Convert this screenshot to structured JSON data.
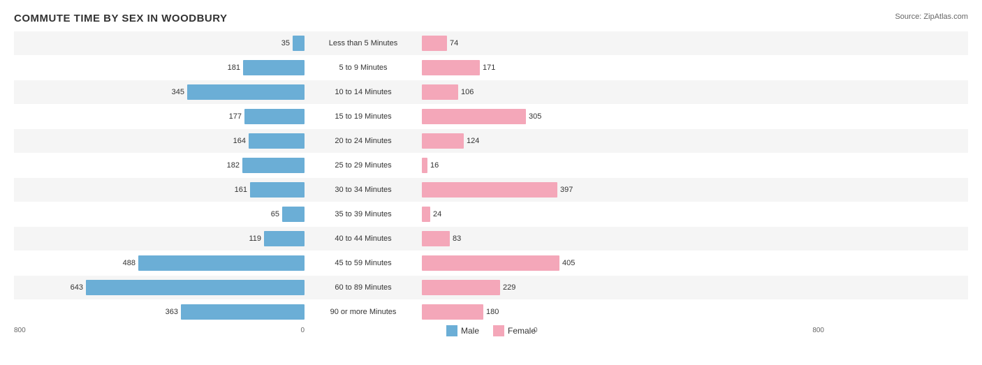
{
  "title": "COMMUTE TIME BY SEX IN WOODBURY",
  "source": "Source: ZipAtlas.com",
  "max_value": 800,
  "axis_labels": {
    "left_min": "800",
    "left_max": "0",
    "right_min": "0",
    "right_max": "800"
  },
  "legend": {
    "male_label": "Male",
    "female_label": "Female"
  },
  "rows": [
    {
      "label": "Less than 5 Minutes",
      "male": 35,
      "female": 74
    },
    {
      "label": "5 to 9 Minutes",
      "male": 181,
      "female": 171
    },
    {
      "label": "10 to 14 Minutes",
      "male": 345,
      "female": 106
    },
    {
      "label": "15 to 19 Minutes",
      "male": 177,
      "female": 305
    },
    {
      "label": "20 to 24 Minutes",
      "male": 164,
      "female": 124
    },
    {
      "label": "25 to 29 Minutes",
      "male": 182,
      "female": 16
    },
    {
      "label": "30 to 34 Minutes",
      "male": 161,
      "female": 397
    },
    {
      "label": "35 to 39 Minutes",
      "male": 65,
      "female": 24
    },
    {
      "label": "40 to 44 Minutes",
      "male": 119,
      "female": 83
    },
    {
      "label": "45 to 59 Minutes",
      "male": 488,
      "female": 405
    },
    {
      "label": "60 to 89 Minutes",
      "male": 643,
      "female": 229
    },
    {
      "label": "90 or more Minutes",
      "male": 363,
      "female": 180
    }
  ]
}
